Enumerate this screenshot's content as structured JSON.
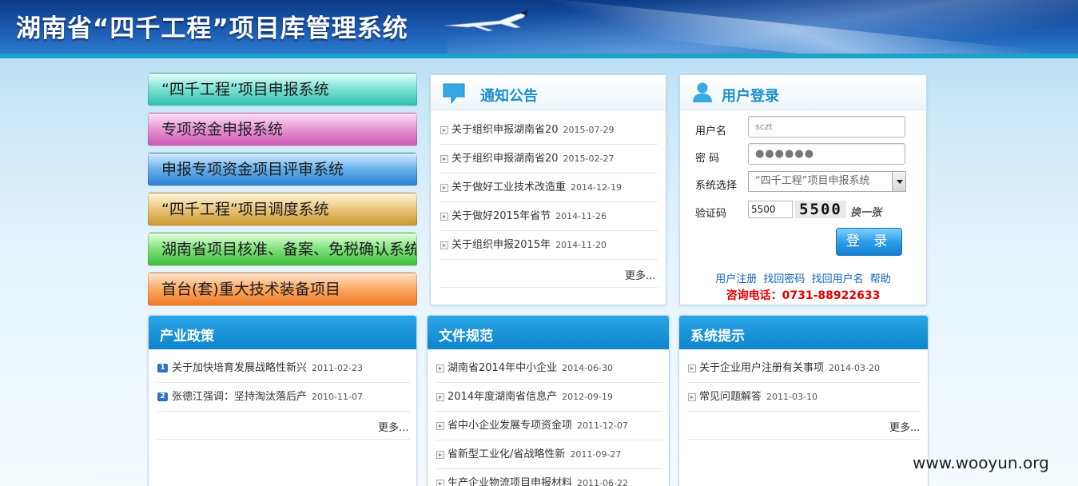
{
  "header": {
    "title": "湖南省“四千工程”项目库管理系统"
  },
  "systems": [
    {
      "label": "“四千工程”项目申报系统"
    },
    {
      "label": "专项资金申报系统"
    },
    {
      "label": "申报专项资金项目评审系统"
    },
    {
      "label": "“四千工程”项目调度系统"
    },
    {
      "label": "湖南省项目核准、备案、免税确认系统"
    },
    {
      "label": "首台(套)重大技术装备项目"
    }
  ],
  "notice": {
    "title": "通知公告",
    "items": [
      {
        "text": "关于组织申报湖南省20",
        "date": "2015-07-29"
      },
      {
        "text": "关于组织申报湖南省20",
        "date": "2015-02-27"
      },
      {
        "text": "关于做好工业技术改造重",
        "date": "2014-12-19"
      },
      {
        "text": "关于做好2015年省节",
        "date": "2014-11-26"
      },
      {
        "text": "关于组织申报2015年",
        "date": "2014-11-20"
      }
    ],
    "more": "更多..."
  },
  "login": {
    "title": "用户登录",
    "username_label": "用户名",
    "username_value": "sczt",
    "password_label": "密 码",
    "password_value": "●●●●●●",
    "system_label": "系统选择",
    "system_value": "“四千工程”项目申报系统",
    "captcha_label": "验证码",
    "captcha_value": "5500",
    "captcha_image": "5500",
    "change_label": "换一张",
    "submit_label": "登 录",
    "links": [
      "用户注册",
      "找回密码",
      "找回用户名",
      "帮助"
    ],
    "phone": "咨询电话：0731-88922633"
  },
  "policy": {
    "title": "产业政策",
    "items": [
      {
        "num": "1",
        "text": "关于加快培育发展战略性新兴",
        "date": "2011-02-23"
      },
      {
        "num": "2",
        "text": "张德江强调：坚持淘汰落后产",
        "date": "2010-11-07"
      }
    ],
    "more": "更多..."
  },
  "docs": {
    "title": "文件规范",
    "items": [
      {
        "text": "湖南省2014年中小企业",
        "date": "2014-06-30"
      },
      {
        "text": "2014年度湖南省信息产",
        "date": "2012-09-19"
      },
      {
        "text": "省中小企业发展专项资金项",
        "date": "2011-12-07"
      },
      {
        "text": "省新型工业化/省战略性新",
        "date": "2011-09-27"
      },
      {
        "text": "生产企业物流项目申报材料",
        "date": "2011-06-22"
      }
    ]
  },
  "tips": {
    "title": "系统提示",
    "items": [
      {
        "text": "关于企业用户注册有关事项",
        "date": "2014-03-20"
      },
      {
        "text": "常见问题解答",
        "date": "2011-03-10"
      }
    ],
    "more": "更多..."
  },
  "watermark": "www.wooyun.org"
}
